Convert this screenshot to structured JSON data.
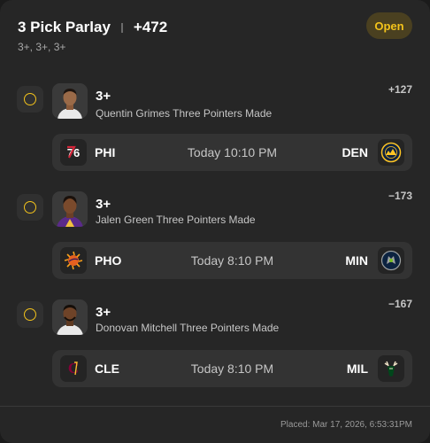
{
  "header": {
    "title": "3 Pick Parlay",
    "total_odds": "+472",
    "subtitle": "3+, 3+, 3+",
    "status": "Open"
  },
  "picks": [
    {
      "value": "3+",
      "description": "Quentin Grimes Three Pointers Made",
      "odds": "+127",
      "game": {
        "away": "PHI",
        "time": "Today 10:10 PM",
        "home": "DEN",
        "away_icon": "76ers-logo-icon",
        "home_icon": "nuggets-logo-icon"
      }
    },
    {
      "value": "3+",
      "description": "Jalen Green Three Pointers Made",
      "odds": "−173",
      "game": {
        "away": "PHO",
        "time": "Today 8:10 PM",
        "home": "MIN",
        "away_icon": "suns-logo-icon",
        "home_icon": "timberwolves-logo-icon"
      }
    },
    {
      "value": "3+",
      "description": "Donovan Mitchell Three Pointers Made",
      "odds": "−167",
      "game": {
        "away": "CLE",
        "time": "Today 8:10 PM",
        "home": "MIL",
        "away_icon": "cavaliers-logo-icon",
        "home_icon": "bucks-logo-icon"
      }
    }
  ],
  "footer": {
    "placed": "Placed: Mar 17, 2026, 6:53:31PM"
  },
  "colors": {
    "background": "#262626",
    "accent": "#f2c21b",
    "badge_bg": "#4a4020",
    "row_bg": "#333333"
  }
}
